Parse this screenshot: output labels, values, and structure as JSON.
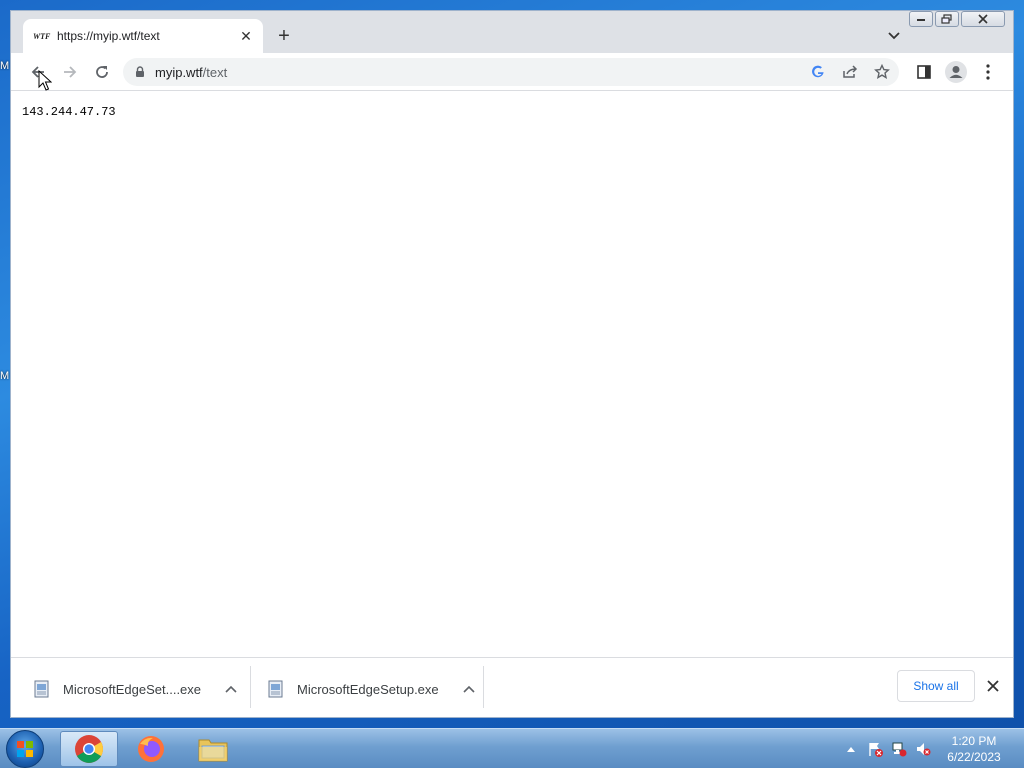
{
  "browser": {
    "tab": {
      "favicon_text": "WTF",
      "title": "https://myip.wtf/text"
    },
    "address_bar": {
      "host": "myip.wtf",
      "path": "/text"
    },
    "content": {
      "ip_address": "143.244.47.73"
    }
  },
  "downloads": {
    "items": [
      {
        "name": "MicrosoftEdgeSet....exe"
      },
      {
        "name": "MicrosoftEdgeSetup.exe"
      }
    ],
    "show_all_label": "Show all"
  },
  "desktop": {
    "edge_label_1": "M",
    "edge_label_2": "M"
  },
  "taskbar": {
    "apps": [
      "chrome",
      "firefox",
      "file-explorer"
    ],
    "clock": {
      "time": "1:20 PM",
      "date": "6/22/2023"
    }
  },
  "colors": {
    "accent": "#1a73e8",
    "tab_strip": "#dee1e6",
    "taskbar": "#6f9fd0"
  }
}
